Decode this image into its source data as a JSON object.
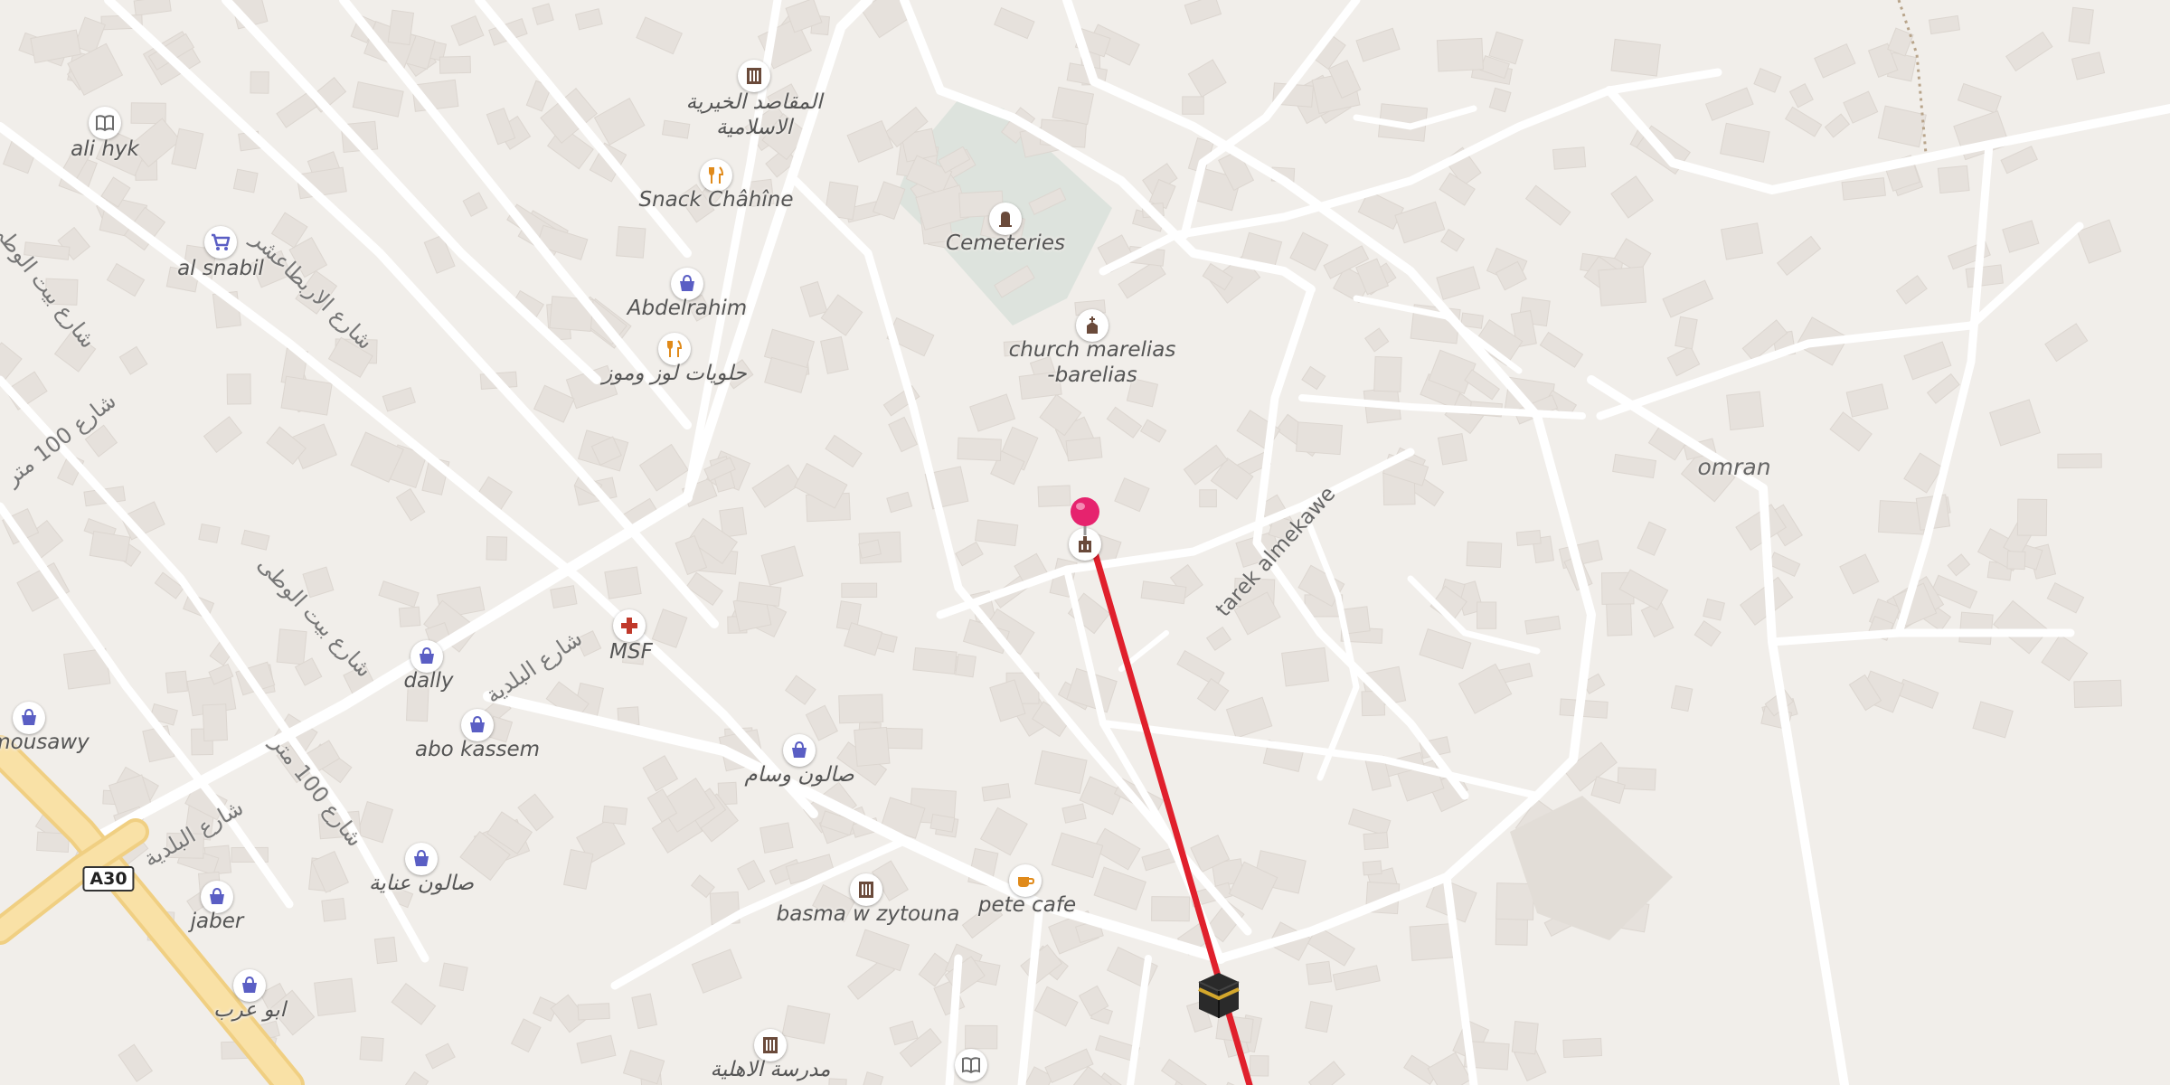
{
  "map": {
    "background": "#f1eeea",
    "road_color": "#ffffff",
    "building_color": "#e6e1dc",
    "cemetery_color": "#dde3dd",
    "highway_color": "#f6dc9a",
    "route_color": "#e0202c",
    "pin_color": "#e6236e"
  },
  "labels": {
    "ali_hyk": "ali hyk",
    "al_snabil": "al snabil",
    "maqasid": "المقاصد الخيرية الاسلامية",
    "snack_chahine": "Snack Châhîne",
    "abdelrahim": "Abdelrahim",
    "halawiyat": "حلويات لوز وموز",
    "cemeteries": "Cemeteries",
    "church": "church marelias -barelias",
    "omran": "omran",
    "tarek": "tarek almekawe",
    "msf": "MSF",
    "dally": "dally",
    "abo_kassem": "abo kassem",
    "mousawy": "mousawy",
    "salon_wisam": "صالون وسام",
    "salon_inaya": "صالون عناية",
    "jaber": "jaber",
    "abu_arab": "ابو عرب",
    "basma": "basma w zytouna",
    "pete_cafe": "pete cafe",
    "madrasa": "مدرسة الاهلية"
  },
  "streets": {
    "arbatashar": "شارع الاربطاعشر",
    "bayt_wataa": "شارع بيت الوطى",
    "baladiya": "شارع البلدية",
    "m100": "شارع 100 متر"
  },
  "route_shield": "A30",
  "icons": {
    "book": "book-icon",
    "cart": "shopping-cart-icon",
    "bag": "shopping-bag-icon",
    "restaurant": "restaurant-icon",
    "school": "school-icon",
    "cemetery": "grave-icon",
    "church": "church-icon",
    "medical": "medical-cross-icon",
    "cafe": "cafe-icon",
    "pin": "location-pin-icon",
    "kaaba": "kaaba-icon"
  }
}
